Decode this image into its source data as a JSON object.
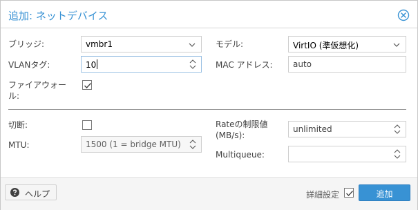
{
  "dialog": {
    "title": "追加: ネットデバイス",
    "close_icon": "close-circle-icon"
  },
  "form": {
    "bridge": {
      "label": "ブリッジ:",
      "value": "vmbr1"
    },
    "vlan_tag": {
      "label": "VLANタグ:",
      "value": "10"
    },
    "firewall": {
      "label_line1": "ファイアウォー",
      "label_line2": "ル:",
      "checked": true
    },
    "model": {
      "label": "モデル:",
      "value": "VirtIO (準仮想化)"
    },
    "mac_address": {
      "label": "MAC アドレス:",
      "value": "auto"
    },
    "disconnect": {
      "label": "切断:",
      "checked": false
    },
    "mtu": {
      "label": "MTU:",
      "value": "1500 (1 = bridge MTU)"
    },
    "rate_limit": {
      "label_line1": "Rateの制限値",
      "label_line2": "(MB/s):",
      "value": "unlimited"
    },
    "multiqueue": {
      "label": "Multiqueue:",
      "value": ""
    }
  },
  "footer": {
    "help_label": "ヘルプ",
    "help_icon": "question-circle-icon",
    "advanced_label": "詳細設定",
    "advanced_checked": true,
    "add_label": "追加"
  },
  "colors": {
    "accent": "#3892d4",
    "text": "#404040"
  }
}
